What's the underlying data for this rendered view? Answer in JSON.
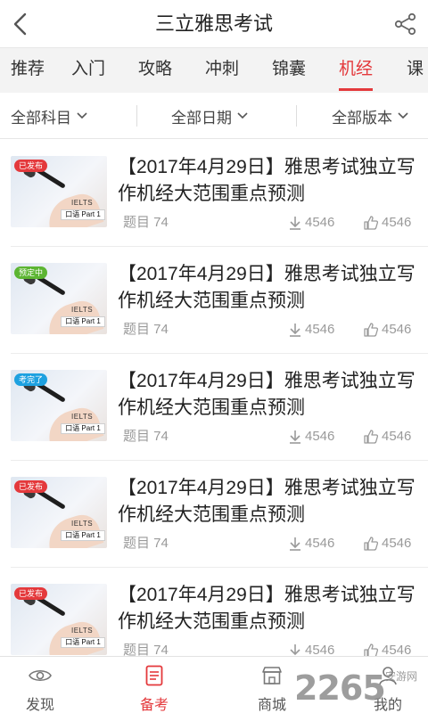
{
  "header": {
    "title": "三立雅思考试",
    "back_icon": "chevron-left-icon",
    "share_icon": "share-icon"
  },
  "tabs": [
    {
      "label": "推荐",
      "active": false
    },
    {
      "label": "入门",
      "active": false
    },
    {
      "label": "攻略",
      "active": false
    },
    {
      "label": "冲刺",
      "active": false
    },
    {
      "label": "锦囊",
      "active": false
    },
    {
      "label": "机经",
      "active": true
    },
    {
      "label": "课",
      "active": false
    }
  ],
  "filters": [
    {
      "label": "全部科目"
    },
    {
      "label": "全部日期"
    },
    {
      "label": "全部版本"
    }
  ],
  "items": [
    {
      "badge": "已发布",
      "badge_color": "#e4393c",
      "title": "【2017年4月29日】雅思考试独立写作机经大范围重点预测",
      "questions": "题目 74",
      "downloads": "4546",
      "likes": "4546",
      "thumb_label": "IELTS",
      "thumb_part": "口语 Part 1"
    },
    {
      "badge": "预定中",
      "badge_color": "#5cb532",
      "title": "【2017年4月29日】雅思考试独立写作机经大范围重点预测",
      "questions": "题目 74",
      "downloads": "4546",
      "likes": "4546",
      "thumb_label": "IELTS",
      "thumb_part": "口语 Part 1"
    },
    {
      "badge": "考完了",
      "badge_color": "#1ea1e0",
      "title": "【2017年4月29日】雅思考试独立写作机经大范围重点预测",
      "questions": "题目 74",
      "downloads": "4546",
      "likes": "4546",
      "thumb_label": "IELTS",
      "thumb_part": "口语 Part 1"
    },
    {
      "badge": "已发布",
      "badge_color": "#e4393c",
      "title": "【2017年4月29日】雅思考试独立写作机经大范围重点预测",
      "questions": "题目 74",
      "downloads": "4546",
      "likes": "4546",
      "thumb_label": "IELTS",
      "thumb_part": "口语 Part 1"
    },
    {
      "badge": "已发布",
      "badge_color": "#e4393c",
      "title": "【2017年4月29日】雅思考试独立写作机经大范围重点预测",
      "questions": "题目 74",
      "downloads": "4546",
      "likes": "4546",
      "thumb_label": "IELTS",
      "thumb_part": "口语 Part 1"
    }
  ],
  "bottom_nav": [
    {
      "label": "发现",
      "icon": "eye-icon",
      "active": false
    },
    {
      "label": "备考",
      "icon": "list-doc-icon",
      "active": true
    },
    {
      "label": "商城",
      "icon": "store-icon",
      "active": false
    },
    {
      "label": "我的",
      "icon": "user-icon",
      "active": false
    }
  ],
  "watermark": {
    "number": "2265",
    "text": "安游网"
  },
  "colors": {
    "accent": "#e4393c",
    "muted": "#9a9a9a"
  }
}
